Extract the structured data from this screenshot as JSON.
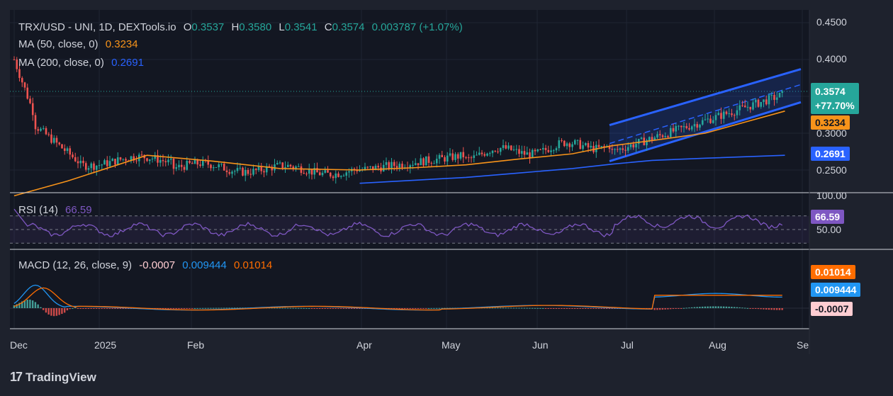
{
  "colors": {
    "bg": "#1e222d",
    "pane": "#131722",
    "up": "#26a69a",
    "down": "#ef5350",
    "ma50": "#f7931a",
    "ma200": "#2962ff",
    "rsi": "#7e57c2",
    "macd": "#2196f3",
    "signal": "#ff6d00",
    "channel": "#2962ff"
  },
  "header": {
    "symbol": "TRX/USD - UNI, 1D, DEXTools.io",
    "o_label": "O",
    "o_value": "0.3537",
    "h_label": "H",
    "h_value": "0.3580",
    "l_label": "L",
    "l_value": "0.3541",
    "c_label": "C",
    "c_value": "0.3574",
    "change": "0.003787 (+1.07%)"
  },
  "indicators": {
    "ma50_label": "MA (50, close, 0)",
    "ma50_value": "0.3234",
    "ma200_label": "MA (200, close, 0)",
    "ma200_value": "0.2691",
    "rsi_label": "RSI (14)",
    "rsi_value": "66.59",
    "macd_label": "MACD (12, 26, close, 9)",
    "macd_hist": "-0.0007",
    "macd_line": "0.009444",
    "macd_signal": "0.01014"
  },
  "price_axis": [
    "0.4500",
    "0.4000",
    "0.3000",
    "0.2500"
  ],
  "rsi_axis": [
    "100.00",
    "50.00"
  ],
  "badges": {
    "price": "0.3574",
    "pct": "+77.70%",
    "ma50": "0.3234",
    "ma200": "0.2691",
    "rsi": "66.59",
    "signal": "0.01014",
    "macd": "0.009444",
    "hist": "-0.0007"
  },
  "time_axis": [
    "Dec",
    "2025",
    "Feb",
    "Apr",
    "May",
    "Jun",
    "Jul",
    "Aug",
    "Se"
  ],
  "branding": "TradingView",
  "chart_data": {
    "type": "candlestick",
    "ylim": [
      0.23,
      0.46
    ],
    "ma50": [
      [
        0,
        0.215
      ],
      [
        20,
        0.235
      ],
      [
        50,
        0.27
      ],
      [
        75,
        0.262
      ],
      [
        100,
        0.252
      ],
      [
        130,
        0.25
      ],
      [
        150,
        0.253
      ],
      [
        170,
        0.257
      ],
      [
        190,
        0.265
      ],
      [
        210,
        0.272
      ],
      [
        225,
        0.283
      ],
      [
        240,
        0.29
      ],
      [
        260,
        0.3
      ],
      [
        275,
        0.315
      ],
      [
        290,
        0.33
      ]
    ],
    "ma200": [
      [
        130,
        0.232
      ],
      [
        150,
        0.236
      ],
      [
        170,
        0.24
      ],
      [
        190,
        0.246
      ],
      [
        210,
        0.252
      ],
      [
        225,
        0.258
      ],
      [
        240,
        0.263
      ],
      [
        260,
        0.266
      ],
      [
        290,
        0.27
      ]
    ],
    "channel": {
      "upper": [
        [
          224,
          0.311
        ],
        [
          296,
          0.387
        ]
      ],
      "lower": [
        [
          224,
          0.262
        ],
        [
          296,
          0.342
        ]
      ],
      "mid": [
        [
          224,
          0.286
        ],
        [
          296,
          0.366
        ]
      ]
    },
    "rsi_range": [
      0,
      100
    ],
    "macd_range": [
      -0.02,
      0.06
    ]
  }
}
